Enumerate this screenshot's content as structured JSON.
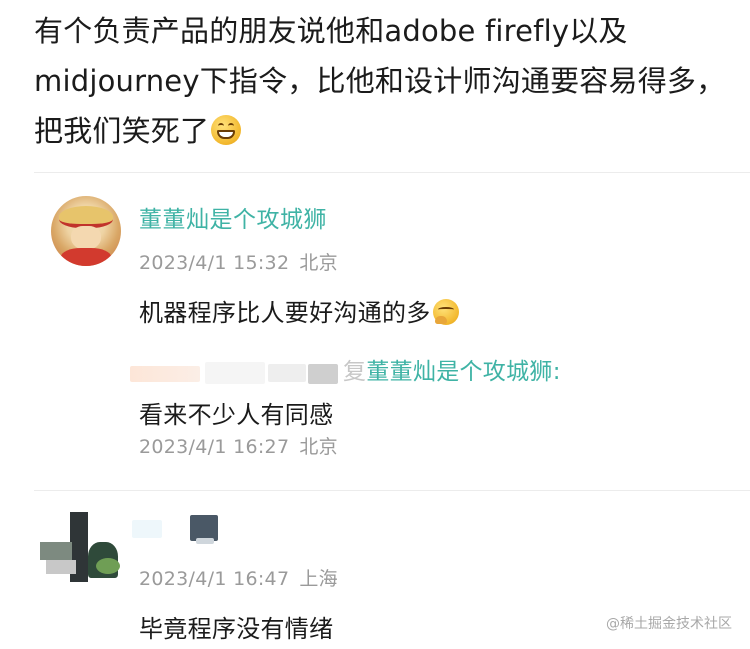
{
  "post": {
    "text_before_emoji": "有个负责产品的朋友说他和adobe firefly以及midjourney下指令，比他和设计师沟通要容易得多，把我们笑死了",
    "emoji": "grin-icon"
  },
  "comment1": {
    "username": "董董灿是个攻城狮",
    "date": "2023/4/1 15:32",
    "location": "北京",
    "text": "机器程序比人要好沟通的多",
    "emoji": "thinking-icon"
  },
  "reply1": {
    "at_prefix": "复",
    "reply_to": "董董灿是个攻城狮:",
    "text": "看来不少人有同感",
    "date": "2023/4/1 16:27",
    "location": "北京"
  },
  "comment2": {
    "date": "2023/4/1 16:47",
    "location": "上海",
    "text": "毕竟程序没有情绪"
  },
  "watermark": "@稀土掘金技术社区",
  "colors": {
    "username": "#3fb3a5",
    "meta": "#9a9a9a",
    "text": "#1b1b1b"
  }
}
